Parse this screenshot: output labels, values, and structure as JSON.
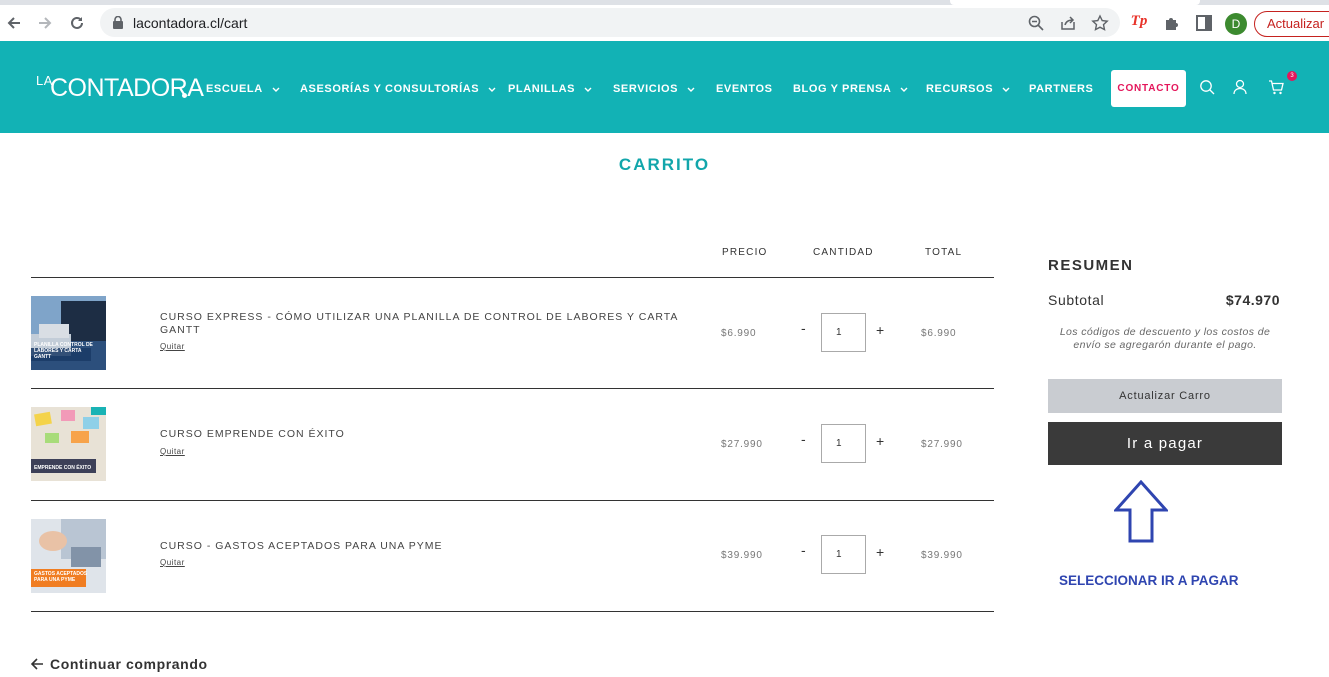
{
  "browser": {
    "url": "lacontadora.cl/cart",
    "profile_initial": "D",
    "update_label": "Actualizar"
  },
  "header": {
    "logo_la": "LA",
    "logo_main": "CONTADORA",
    "menu": [
      {
        "label": "ESCUELA",
        "dropdown": true
      },
      {
        "label": "ASESORÍAS Y CONSULTORÍAS",
        "dropdown": true
      },
      {
        "label": "PLANILLAS",
        "dropdown": true
      },
      {
        "label": "SERVICIOS",
        "dropdown": true
      },
      {
        "label": "EVENTOS",
        "dropdown": false
      },
      {
        "label": "BLOG Y PRENSA",
        "dropdown": true
      },
      {
        "label": "RECURSOS",
        "dropdown": true
      },
      {
        "label": "PARTNERS",
        "dropdown": false
      }
    ],
    "contact_label": "CONTACTO",
    "cart_count": "3",
    "colors": {
      "brand": "#12b2b5",
      "accent": "#e4165b"
    }
  },
  "page": {
    "title": "CARRITO"
  },
  "cart": {
    "columns": {
      "price": "PRECIO",
      "quantity": "CANTIDAD",
      "total": "TOTAL"
    },
    "remove_label": "Quitar",
    "items": [
      {
        "name": "CURSO EXPRESS - CÓMO UTILIZAR UNA PLANILLA DE CONTROL DE LABORES Y CARTA GANTT",
        "thumb_caption": "PLANILLA CONTROL DE LABORES Y CARTA GANTT",
        "price": "$6.990",
        "qty": "1",
        "total": "$6.990"
      },
      {
        "name": "CURSO EMPRENDE CON ÉXITO",
        "thumb_caption": "EMPRENDE CON ÉXITO",
        "price": "$27.990",
        "qty": "1",
        "total": "$27.990"
      },
      {
        "name": "CURSO - GASTOS ACEPTADOS PARA UNA PYME",
        "thumb_caption": "GASTOS ACEPTADOS PARA UNA PYME",
        "price": "$39.990",
        "qty": "1",
        "total": "$39.990"
      }
    ],
    "continue_label": "Continuar comprando"
  },
  "summary": {
    "title": "RESUMEN",
    "subtotal_label": "Subtotal",
    "subtotal_value": "$74.970",
    "note": "Los códigos de descuento y los costos de envío se agregarón durante el pago.",
    "update_button": "Actualizar Carro",
    "pay_button": "Ir a pagar"
  },
  "annotation": {
    "text": "SELECCIONAR IR A PAGAR",
    "color": "#2f45b0"
  }
}
